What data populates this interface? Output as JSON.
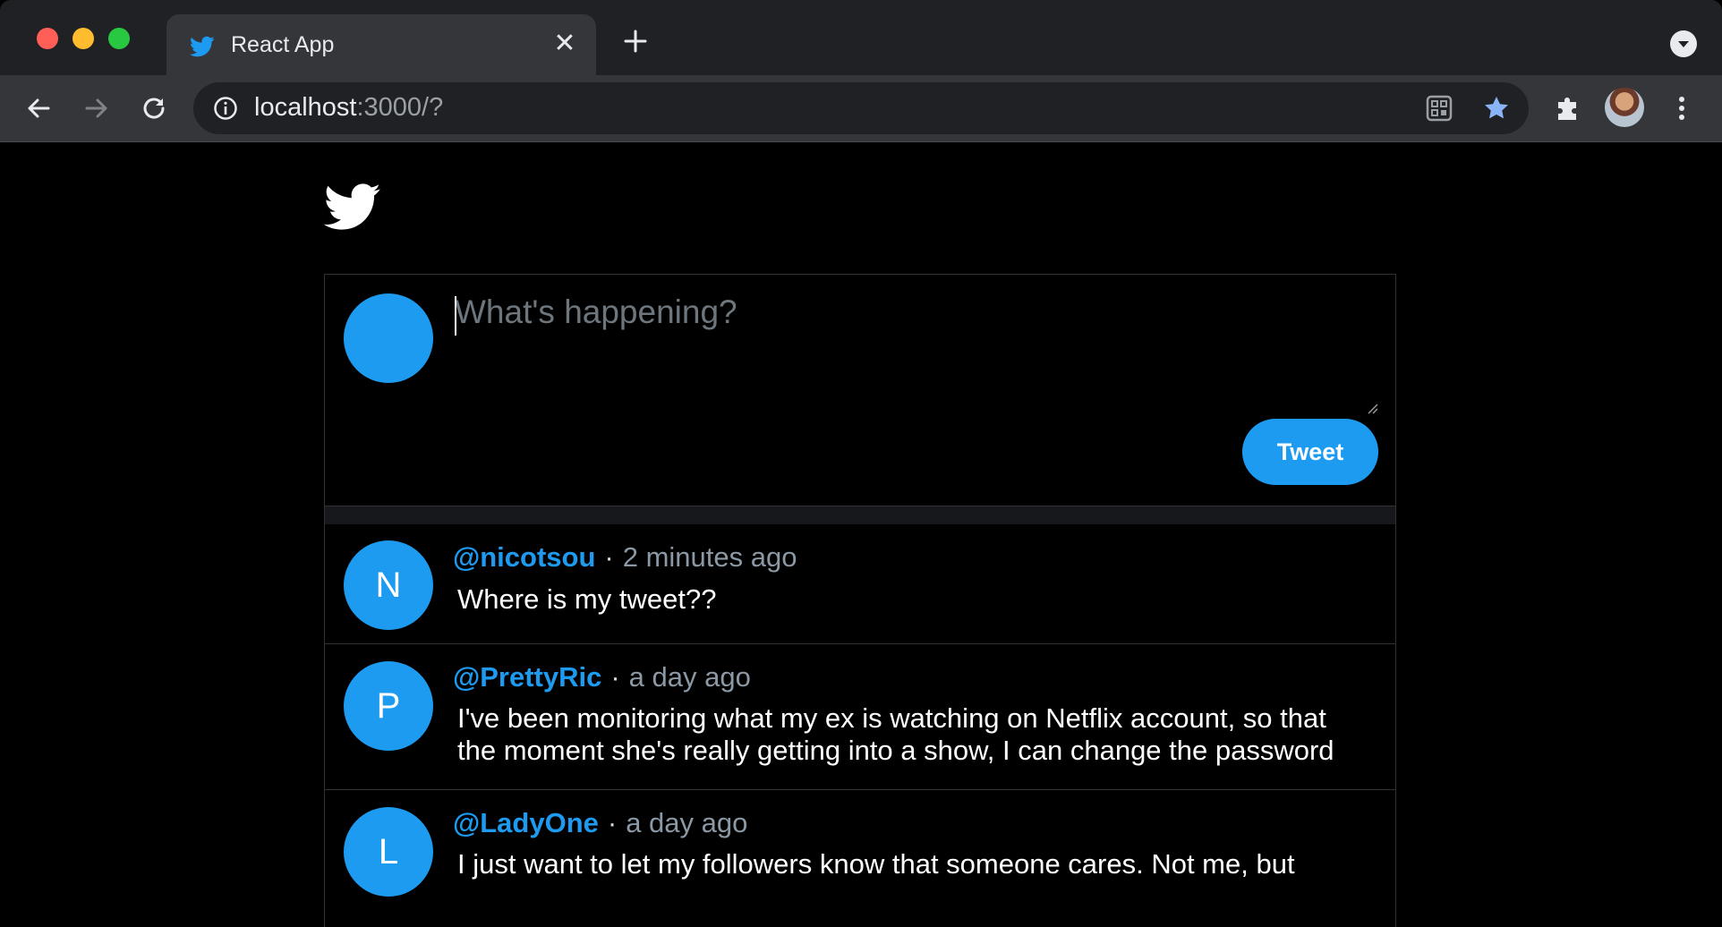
{
  "browser": {
    "tab_title": "React App",
    "url_host": "localhost",
    "url_rest": ":3000/?",
    "icons": [
      "twitter-icon",
      "close-icon",
      "plus-icon",
      "tab-search-icon",
      "back-arrow-icon",
      "forward-arrow-icon",
      "reload-icon",
      "info-icon",
      "qr-code-icon",
      "star-icon",
      "puzzle-icon",
      "profile-avatar",
      "more-vert-icon"
    ]
  },
  "compose": {
    "placeholder": "What's happening?",
    "button_label": "Tweet"
  },
  "tweets": [
    {
      "initial": "N",
      "handle": "@nicotsou",
      "sep": "·",
      "time": "2 minutes ago",
      "text": "Where is my tweet??"
    },
    {
      "initial": "P",
      "handle": "@PrettyRic",
      "sep": "·",
      "time": "a day ago",
      "text": "I've been monitoring what my ex is watching on Netflix account, so that the moment she's really getting into a show, I can change the password"
    },
    {
      "initial": "L",
      "handle": "@LadyOne",
      "sep": "·",
      "time": "a day ago",
      "text": "I just want to let my followers know that someone cares. Not me, but"
    }
  ],
  "colors": {
    "accent": "#1d9bf0",
    "background": "#000000",
    "border": "#2f3336",
    "muted": "#6e767d"
  }
}
